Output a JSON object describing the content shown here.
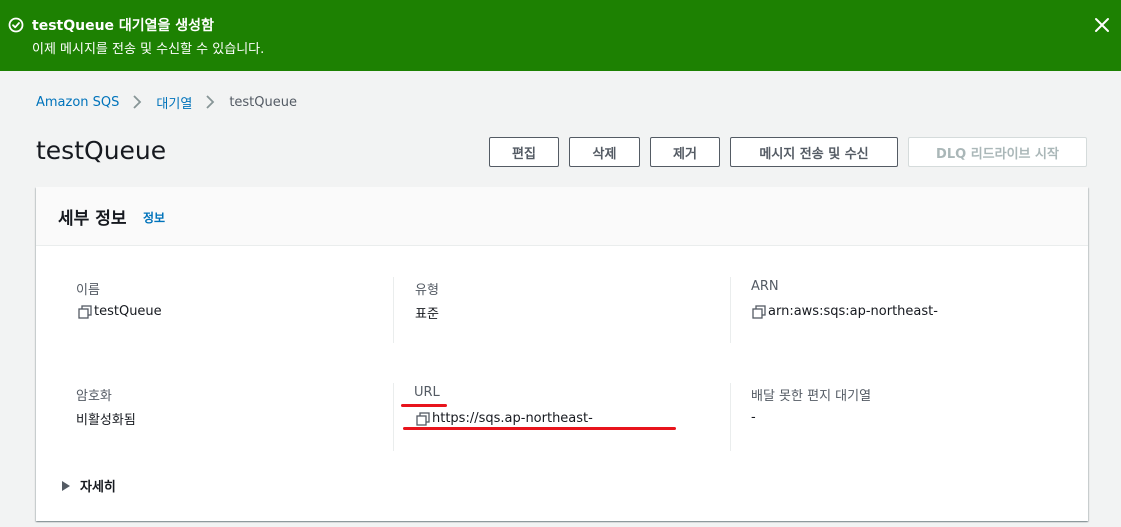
{
  "flash": {
    "title": "testQueue 대기열을 생성함",
    "message": "이제 메시지를 전송 및 수신할 수 있습니다.",
    "icon": "check-circle-icon",
    "close_icon": "close-icon",
    "color": "#1d8102"
  },
  "breadcrumb": {
    "items": [
      "Amazon SQS",
      "대기열",
      "testQueue"
    ]
  },
  "page": {
    "title": "testQueue"
  },
  "actions": {
    "edit": "편집",
    "delete": "삭제",
    "purge": "제거",
    "send_receive": "메시지 전송 및 수신",
    "dlq_redrive": "DLQ 리드라이브 시작"
  },
  "details": {
    "title": "세부 정보",
    "info_link": "정보",
    "fields": {
      "name": {
        "label": "이름",
        "value": "testQueue"
      },
      "type": {
        "label": "유형",
        "value": "표준"
      },
      "arn": {
        "label": "ARN",
        "value": "arn:aws:sqs:ap-northeast-"
      },
      "encryption": {
        "label": "암호화",
        "value": "비활성화됨"
      },
      "url": {
        "label": "URL",
        "value": "https://sqs.ap-northeast-"
      },
      "dlq": {
        "label": "배달 못한 편지 대기열",
        "value": "-"
      }
    },
    "expand_label": "자세히"
  },
  "colors": {
    "link": "#0073bb",
    "annotation": "#e8141c"
  }
}
